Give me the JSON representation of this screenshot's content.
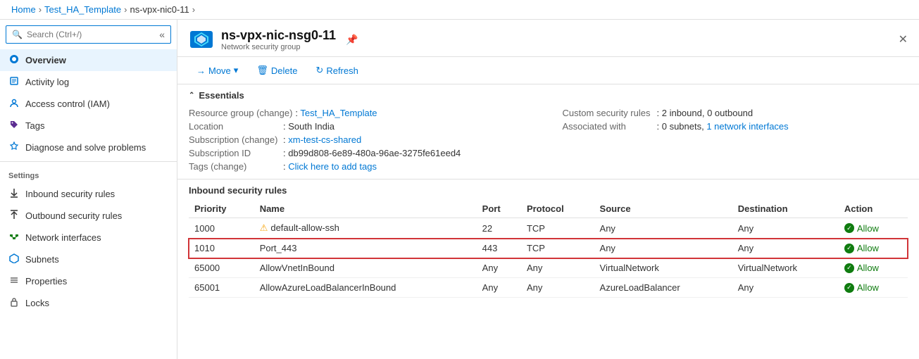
{
  "breadcrumb": {
    "items": [
      "Home",
      "Test_HA_Template",
      "ns-vpx-nic0-11"
    ],
    "separators": [
      ">",
      ">",
      ">"
    ]
  },
  "resource": {
    "title": "ns-vpx-nic-nsg0-11",
    "subtitle": "Network security group",
    "pin_label": "📌",
    "close_label": "✕"
  },
  "toolbar": {
    "move_label": "Move",
    "delete_label": "Delete",
    "refresh_label": "Refresh"
  },
  "essentials": {
    "title": "Essentials",
    "left": [
      {
        "label": "Resource group (change)",
        "value": "Test_HA_Template",
        "is_link": true
      },
      {
        "label": "Location",
        "value": "South India",
        "is_link": false
      },
      {
        "label": "Subscription (change)",
        "value": "xm-test-cs-shared",
        "is_link": true
      },
      {
        "label": "Subscription ID",
        "value": "db99d808-6e89-480a-96ae-3275fe61eed4",
        "is_link": false
      },
      {
        "label": "Tags (change)",
        "value": "Click here to add tags",
        "is_link": true
      }
    ],
    "right": [
      {
        "label": "Custom security rules",
        "value": "2 inbound, 0 outbound",
        "is_link": false
      },
      {
        "label": "Associated with",
        "value": "0 subnets, 1 network interfaces",
        "is_link_partial": true
      }
    ]
  },
  "inbound_rules": {
    "title": "Inbound security rules",
    "columns": [
      "Priority",
      "Name",
      "Port",
      "Protocol",
      "Source",
      "Destination",
      "Action"
    ],
    "rows": [
      {
        "priority": "1000",
        "name": "default-allow-ssh",
        "name_warning": true,
        "port": "22",
        "protocol": "TCP",
        "source": "Any",
        "destination": "Any",
        "action": "Allow",
        "highlighted": false
      },
      {
        "priority": "1010",
        "name": "Port_443",
        "name_warning": false,
        "port": "443",
        "protocol": "TCP",
        "source": "Any",
        "destination": "Any",
        "action": "Allow",
        "highlighted": true
      },
      {
        "priority": "65000",
        "name": "AllowVnetInBound",
        "name_warning": false,
        "port": "Any",
        "protocol": "Any",
        "source": "VirtualNetwork",
        "destination": "VirtualNetwork",
        "action": "Allow",
        "highlighted": false
      },
      {
        "priority": "65001",
        "name": "AllowAzureLoadBalancerInBound",
        "name_warning": false,
        "port": "Any",
        "protocol": "Any",
        "source": "AzureLoadBalancer",
        "destination": "Any",
        "action": "Allow",
        "highlighted": false
      }
    ]
  },
  "sidebar": {
    "search_placeholder": "Search (Ctrl+/)",
    "items": [
      {
        "id": "overview",
        "label": "Overview",
        "icon": "🌐",
        "active": true,
        "section": null
      },
      {
        "id": "activity-log",
        "label": "Activity log",
        "icon": "📋",
        "active": false,
        "section": null
      },
      {
        "id": "access-control",
        "label": "Access control (IAM)",
        "icon": "👤",
        "active": false,
        "section": null
      },
      {
        "id": "tags",
        "label": "Tags",
        "icon": "🏷",
        "active": false,
        "section": null
      },
      {
        "id": "diagnose",
        "label": "Diagnose and solve problems",
        "icon": "🔧",
        "active": false,
        "section": null
      },
      {
        "id": "inbound-rules",
        "label": "Inbound security rules",
        "icon": "↓",
        "active": false,
        "section": "Settings"
      },
      {
        "id": "outbound-rules",
        "label": "Outbound security rules",
        "icon": "↑",
        "active": false,
        "section": null
      },
      {
        "id": "network-interfaces",
        "label": "Network interfaces",
        "icon": "🔌",
        "active": false,
        "section": null
      },
      {
        "id": "subnets",
        "label": "Subnets",
        "icon": "◈",
        "active": false,
        "section": null
      },
      {
        "id": "properties",
        "label": "Properties",
        "icon": "≡",
        "active": false,
        "section": null
      },
      {
        "id": "locks",
        "label": "Locks",
        "icon": "🔒",
        "active": false,
        "section": null
      }
    ]
  },
  "colors": {
    "link": "#0078d4",
    "allow": "#107c10",
    "warning": "#f7a711",
    "highlight_border": "#d13438"
  }
}
